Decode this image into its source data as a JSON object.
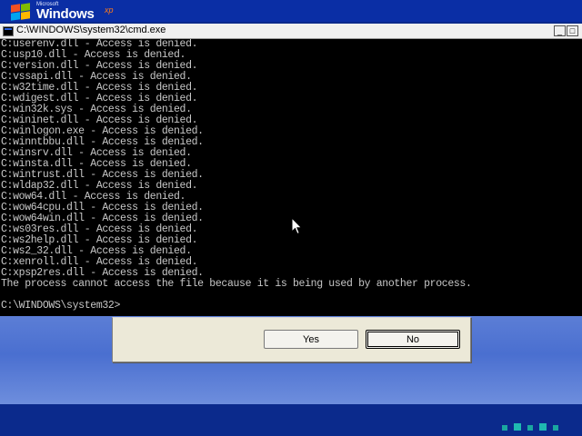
{
  "desktop": {
    "logo": {
      "microsoft": "Microsoft",
      "windows": "Windows",
      "xp": "xp"
    }
  },
  "window": {
    "title": "C:\\WINDOWS\\system32\\cmd.exe",
    "minimize_glyph": "_",
    "restore_glyph": "□"
  },
  "console": {
    "lines": [
      "C:userenv.dll - Access is denied.",
      "C:usp10.dll - Access is denied.",
      "C:version.dll - Access is denied.",
      "C:vssapi.dll - Access is denied.",
      "C:w32time.dll - Access is denied.",
      "C:wdigest.dll - Access is denied.",
      "C:win32k.sys - Access is denied.",
      "C:wininet.dll - Access is denied.",
      "C:winlogon.exe - Access is denied.",
      "C:winntbbu.dll - Access is denied.",
      "C:winsrv.dll - Access is denied.",
      "C:winsta.dll - Access is denied.",
      "C:wintrust.dll - Access is denied.",
      "C:wldap32.dll - Access is denied.",
      "C:wow64.dll - Access is denied.",
      "C:wow64cpu.dll - Access is denied.",
      "C:wow64win.dll - Access is denied.",
      "C:ws03res.dll - Access is denied.",
      "C:ws2help.dll - Access is denied.",
      "C:ws2_32.dll - Access is denied.",
      "C:xenroll.dll - Access is denied.",
      "C:xpsp2res.dll - Access is denied.",
      "The process cannot access the file because it is being used by another process.",
      "",
      "C:\\WINDOWS\\system32>"
    ]
  },
  "dialog": {
    "yes_label": "Yes",
    "no_label": "No"
  },
  "colors": {
    "console_bg": "#000000",
    "console_fg": "#c8c8c8",
    "desktop_blue": "#4a6fd0",
    "tray_teal": "#1aa7a0"
  }
}
